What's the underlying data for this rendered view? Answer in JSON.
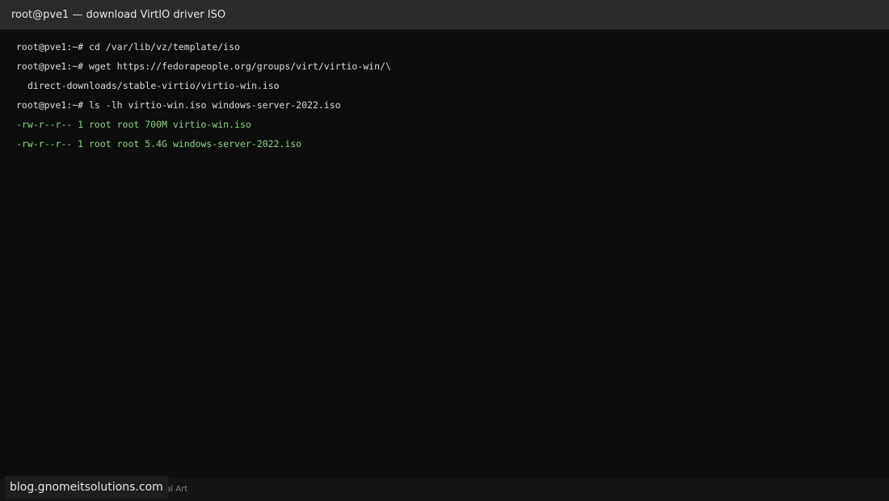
{
  "window": {
    "title": "root@pve1 — download VirtIO driver ISO"
  },
  "terminal": {
    "lines": [
      {
        "type": "command",
        "text": "root@pve1:~# cd /var/lib/vz/template/iso"
      },
      {
        "type": "command",
        "text": "root@pve1:~# wget https://fedorapeople.org/groups/virt/virtio-win/\\"
      },
      {
        "type": "continuation",
        "text": "direct-downloads/stable-virtio/virtio-win.iso"
      },
      {
        "type": "command",
        "text": "root@pve1:~# ls -lh virtio-win.iso windows-server-2022.iso"
      },
      {
        "type": "output",
        "text": "-rw-r--r-- 1 root root 700M virtio-win.iso"
      },
      {
        "type": "output",
        "text": "-rw-r--r-- 1 root root 5.4G windows-server-2022.iso"
      }
    ]
  },
  "footer": {
    "art_label": "utorial Art",
    "watermark": "blog.gnomeitsolutions.com"
  },
  "colors": {
    "background": "#0d0d0d",
    "titlebar": "#2b2b2b",
    "command_text": "#dcdcdc",
    "output_text": "#8fd18a"
  }
}
